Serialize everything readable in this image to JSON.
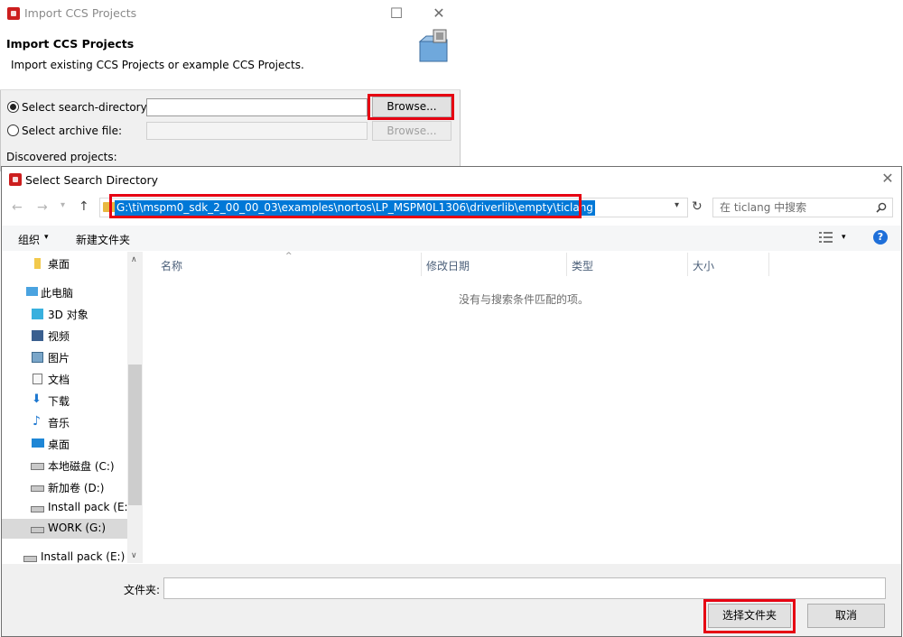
{
  "import_window": {
    "title": "Import CCS Projects",
    "heading": "Import CCS Projects",
    "description": "Import existing CCS Projects or example CCS Projects.",
    "search_dir_label": "Select search-directory:",
    "search_dir_value": "",
    "archive_label": "Select archive file:",
    "archive_value": "",
    "browse_label": "Browse...",
    "browse_disabled_label": "Browse...",
    "discovered_label": "Discovered projects:",
    "search_dir_selected": true
  },
  "dialog": {
    "title": "Select Search Directory",
    "address": "G:\\ti\\mspm0_sdk_2_00_00_03\\examples\\nortos\\LP_MSPM0L1306\\driverlib\\empty\\ticlang",
    "search_placeholder": "在 ticlang 中搜索",
    "toolbar": {
      "organize": "组织",
      "new_folder": "新建文件夹"
    },
    "nav_items": [
      {
        "label": "桌面",
        "icon": "folder-icon",
        "selected": false
      },
      {
        "label": "此电脑",
        "icon": "computer-icon",
        "selected": false
      },
      {
        "label": "3D 对象",
        "icon": "3d-objects-icon",
        "selected": false
      },
      {
        "label": "视频",
        "icon": "video-icon",
        "selected": false
      },
      {
        "label": "图片",
        "icon": "pictures-icon",
        "selected": false
      },
      {
        "label": "文档",
        "icon": "documents-icon",
        "selected": false
      },
      {
        "label": "下载",
        "icon": "download-icon",
        "selected": false
      },
      {
        "label": "音乐",
        "icon": "music-icon",
        "selected": false
      },
      {
        "label": "桌面",
        "icon": "desktop-icon",
        "selected": false
      },
      {
        "label": "本地磁盘 (C:)",
        "icon": "drive-c-icon",
        "selected": false
      },
      {
        "label": "新加卷 (D:)",
        "icon": "drive-icon",
        "selected": false
      },
      {
        "label": "Install pack (E:)",
        "icon": "drive-icon",
        "selected": false
      },
      {
        "label": "WORK (G:)",
        "icon": "drive-icon",
        "selected": true
      },
      {
        "label": "Install pack (E:)",
        "icon": "drive-icon",
        "selected": false
      }
    ],
    "columns": [
      "名称",
      "修改日期",
      "类型",
      "大小"
    ],
    "empty_message": "没有与搜索条件匹配的项。",
    "folder_label": "文件夹:",
    "folder_value": "",
    "select_folder_button": "选择文件夹",
    "cancel_button": "取消"
  },
  "colors": {
    "highlight_box": "#e60012",
    "selection_blue": "#0078d7",
    "ti_red": "#cc1e1e"
  }
}
